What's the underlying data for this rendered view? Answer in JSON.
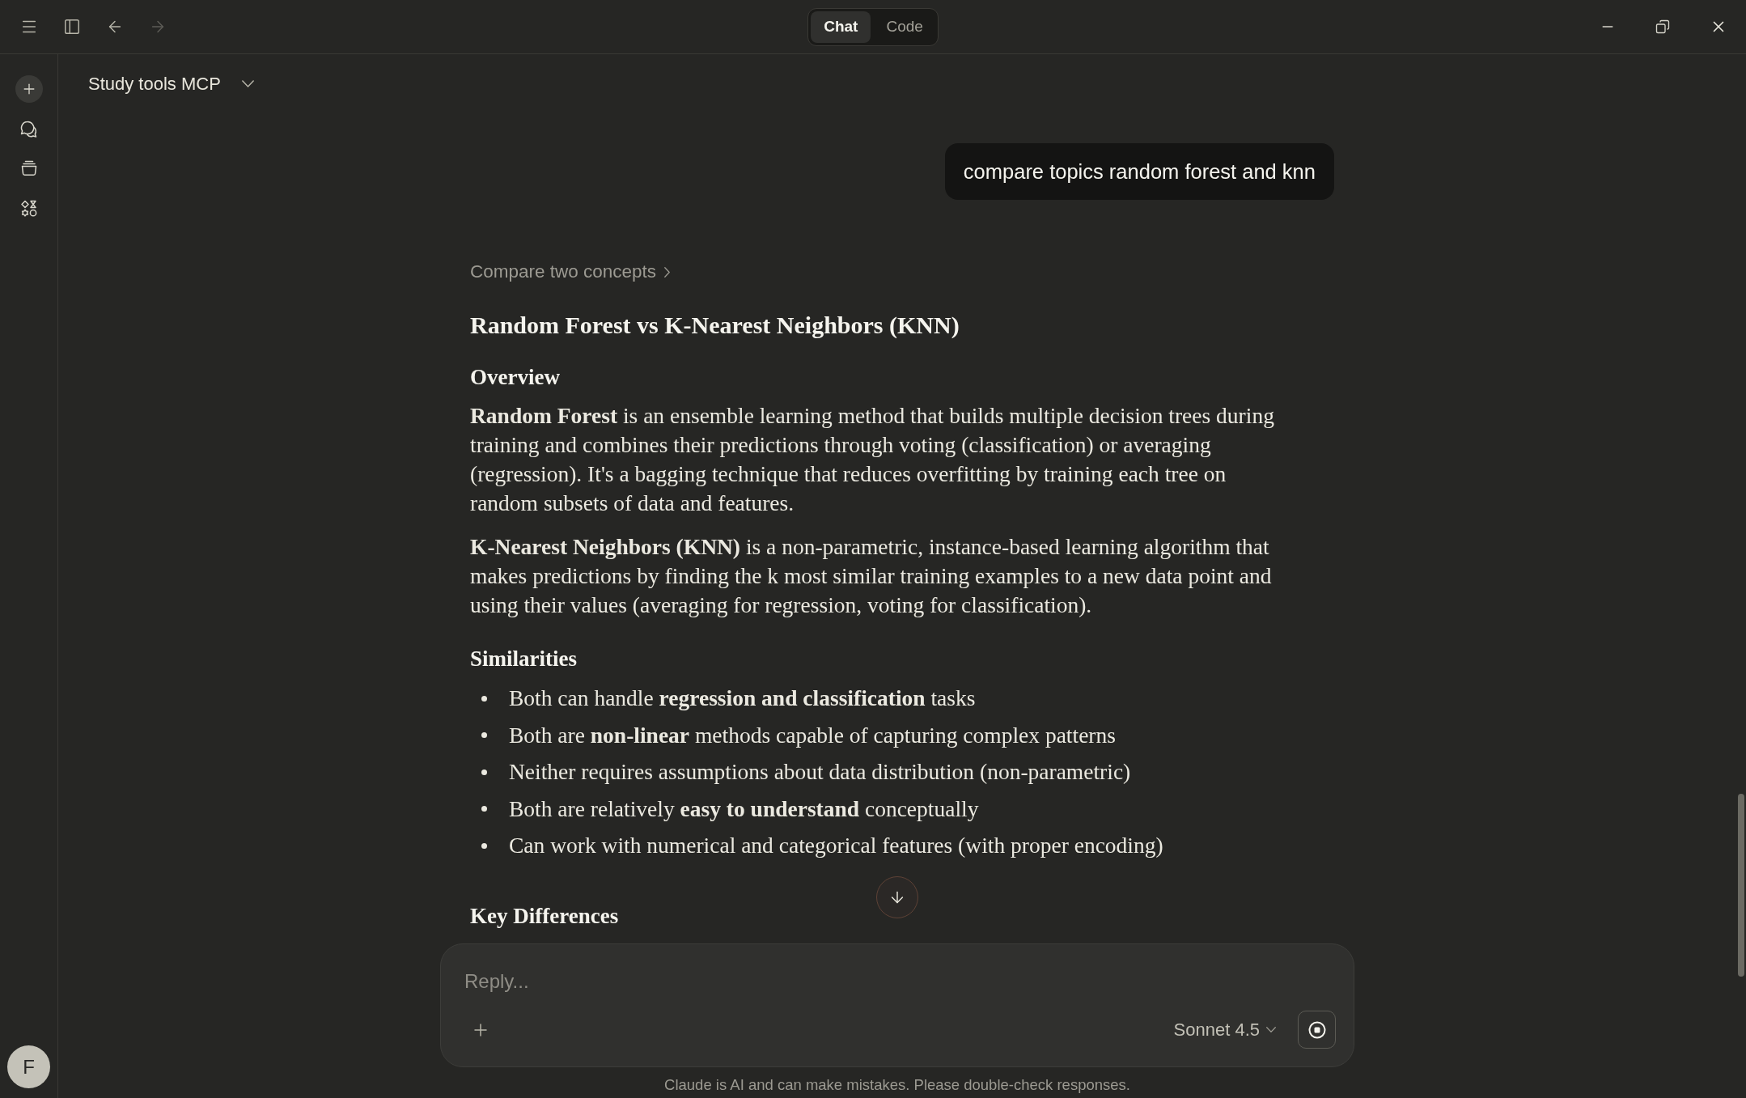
{
  "top_bar": {
    "nav": [
      {
        "kind": "back",
        "disabled": false
      },
      {
        "kind": "forward",
        "disabled": true
      }
    ],
    "mode_tabs": [
      {
        "label": "Chat",
        "selected": true
      },
      {
        "label": "Code",
        "selected": false
      }
    ]
  },
  "sidebar": {
    "avatar_initial": "F"
  },
  "project": {
    "title": "Study tools MCP"
  },
  "user_message": {
    "text": "compare topics random forest and knn"
  },
  "response": {
    "tool_call": "Compare two concepts",
    "title": "Random Forest vs K-Nearest Neighbors (KNN)",
    "sections": [
      {
        "heading": "Overview",
        "paragraphs": [
          "**Random Forest** is an ensemble learning method that builds multiple decision trees during training and combines their predictions through voting (classification) or averaging (regression). It's a bagging technique that reduces overfitting by training each tree on random subsets of data and features.",
          "**K-Nearest Neighbors (KNN)** is a non-parametric, instance-based learning algorithm that makes predictions by finding the k most similar training examples to a new data point and using their values (averaging for regression, voting for classification)."
        ]
      },
      {
        "heading": "Similarities",
        "bullets": [
          "Both can handle **regression and classification** tasks",
          "Both are **non-linear** methods capable of capturing complex patterns",
          "Neither requires assumptions about data distribution (non-parametric)",
          "Both are relatively **easy to understand** conceptually",
          "Can work with numerical and categorical features (with proper encoding)"
        ]
      },
      {
        "heading": "Key Differences"
      }
    ]
  },
  "composer": {
    "placeholder": "Reply...",
    "model": "Sonnet 4.5"
  },
  "disclaimer": "Claude is AI and can make mistakes. Please double-check responses."
}
